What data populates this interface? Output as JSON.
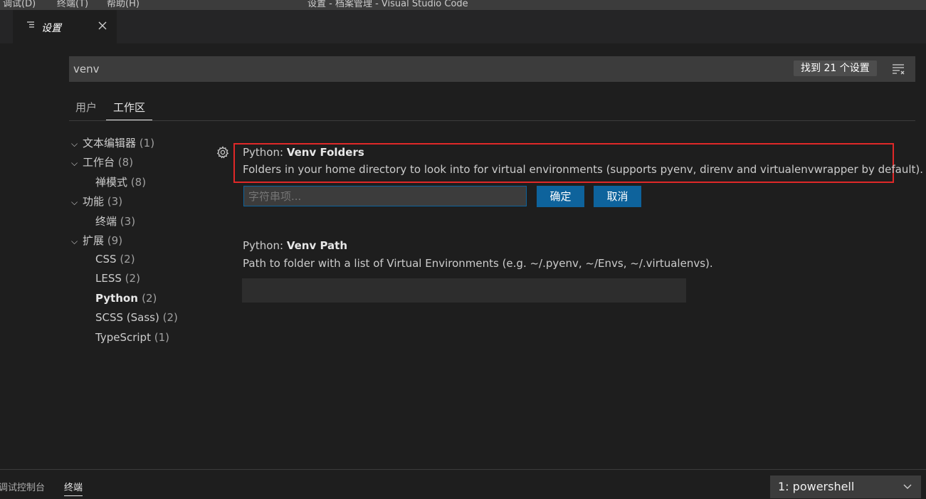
{
  "titlebar": {
    "menu": [
      "调试(D)",
      "终端(T)",
      "帮助(H)"
    ],
    "title": "设置 - 档案管理 - Visual Studio Code"
  },
  "editor_tab": {
    "label": "设置",
    "icon": "settings-file-icon",
    "close_icon": "close-icon"
  },
  "search": {
    "value": "venv",
    "result_count": "找到 21 个设置",
    "filter_icon": "filter-icon"
  },
  "scope_tabs": [
    {
      "label": "用户",
      "active": false
    },
    {
      "label": "工作区",
      "active": true
    }
  ],
  "toc": [
    {
      "label": "文本编辑器",
      "count": "(1)",
      "expanded": true,
      "level": 0
    },
    {
      "label": "工作台",
      "count": "(8)",
      "expanded": true,
      "level": 0
    },
    {
      "label": "禅模式",
      "count": "(8)",
      "level": 1
    },
    {
      "label": "功能",
      "count": "(3)",
      "expanded": true,
      "level": 0
    },
    {
      "label": "终端",
      "count": "(3)",
      "level": 1
    },
    {
      "label": "扩展",
      "count": "(9)",
      "expanded": true,
      "level": 0
    },
    {
      "label": "CSS",
      "count": "(2)",
      "level": 1
    },
    {
      "label": "LESS",
      "count": "(2)",
      "level": 1
    },
    {
      "label": "Python",
      "count": "(2)",
      "level": 1,
      "selected": true
    },
    {
      "label": "SCSS (Sass)",
      "count": "(2)",
      "level": 1
    },
    {
      "label": "TypeScript",
      "count": "(1)",
      "level": 1
    }
  ],
  "settings": [
    {
      "category": "Python: ",
      "name": "Venv Folders",
      "description": "Folders in your home directory to look into for virtual environments (supports pyenv, direnv and virtualenvwrapper by default).",
      "input_placeholder": "字符串项...",
      "ok_label": "确定",
      "cancel_label": "取消"
    },
    {
      "category": "Python: ",
      "name": "Venv Path",
      "description": "Path to folder with a list of Virtual Environments (e.g. ~/.pyenv, ~/Envs, ~/.virtualenvs).",
      "value": ""
    }
  ],
  "panel": {
    "tabs": [
      {
        "label": "调试控制台",
        "active": false
      },
      {
        "label": "终端",
        "active": true
      }
    ],
    "terminal_select": "1: powershell"
  },
  "colors": {
    "accent": "#0e639c",
    "highlight_border": "#e02828",
    "background": "#1e1e1e",
    "input_background": "#3c3c3c"
  }
}
